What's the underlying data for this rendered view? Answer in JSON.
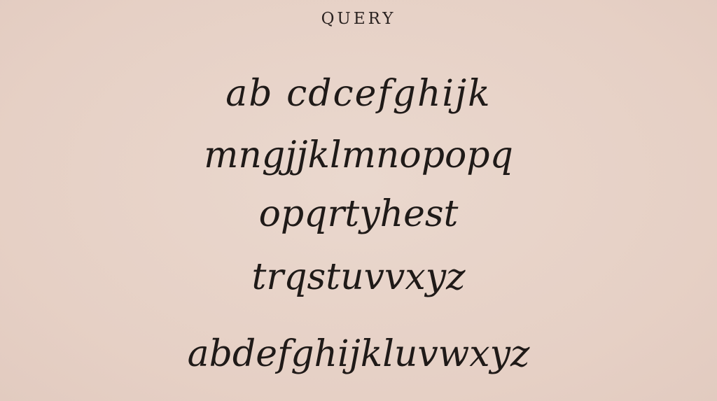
{
  "title": "QUERY",
  "lines": [
    "ab cdcefghijk",
    "mngjjklmnopopq",
    "opqrtyhest",
    "trqstuvvxyz",
    "abdefghijkluvwxyz"
  ]
}
